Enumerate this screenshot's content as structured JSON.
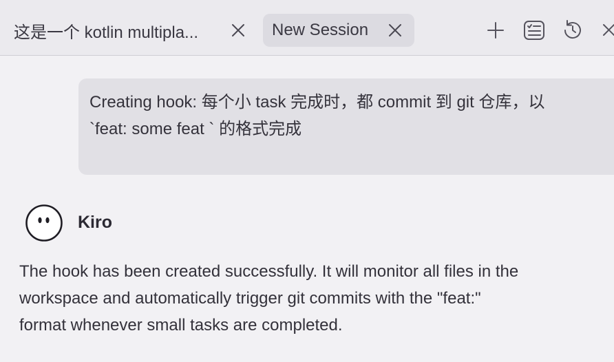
{
  "tabs": [
    {
      "label": "这是一个 kotlin multipla...",
      "active": false
    },
    {
      "label": "New Session",
      "active": true
    }
  ],
  "toolbar": {
    "icons": [
      "plus-icon",
      "checklist-icon",
      "history-icon",
      "close-icon"
    ]
  },
  "user_message": {
    "lines": [
      "Creating hook: 每个小 task 完成时，都 commit 到 git 仓库，以",
      "`feat: some feat ` 的格式完成"
    ]
  },
  "assistant": {
    "name": "Kiro",
    "avatar_icon": "kiro-ghost-icon",
    "lines": [
      "The hook has been created successfully. It will monitor all files in the",
      "workspace and automatically trigger git commits with the \"feat:\"",
      "format whenever small tasks are completed."
    ]
  },
  "colors": {
    "background": "#f2f1f4",
    "tabbar": "#ebeaee",
    "active_tab": "#dcdbe1",
    "user_bubble": "#e1e0e5",
    "text": "#2c2a33"
  }
}
